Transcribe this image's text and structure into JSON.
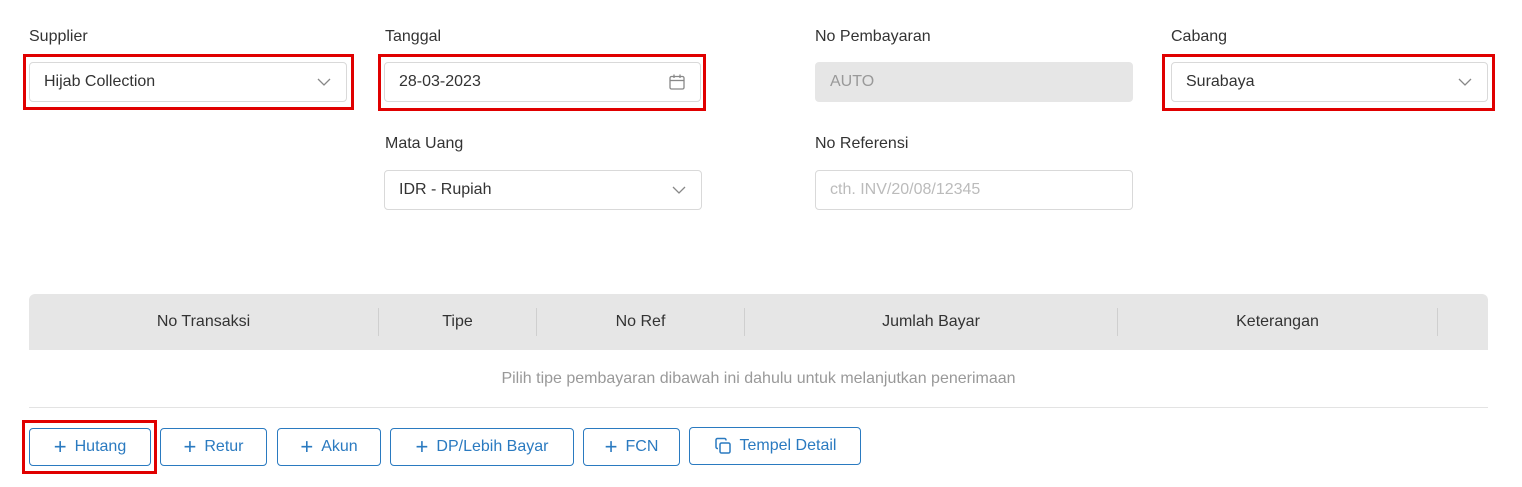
{
  "form": {
    "supplier": {
      "label": "Supplier",
      "value": "Hijab Collection"
    },
    "tanggal": {
      "label": "Tanggal",
      "value": "28-03-2023"
    },
    "no_pembayaran": {
      "label": "No Pembayaran",
      "value": "AUTO"
    },
    "cabang": {
      "label": "Cabang",
      "value": "Surabaya"
    },
    "mata_uang": {
      "label": "Mata Uang",
      "value": "IDR - Rupiah"
    },
    "no_referensi": {
      "label": "No Referensi",
      "placeholder": "cth. INV/20/08/12345"
    }
  },
  "table": {
    "headers": [
      "No Transaksi",
      "Tipe",
      "No Ref",
      "Jumlah Bayar",
      "Keterangan"
    ],
    "empty_message": "Pilih tipe pembayaran dibawah ini dahulu untuk melanjutkan penerimaan"
  },
  "buttons": {
    "hutang": "Hutang",
    "retur": "Retur",
    "akun": "Akun",
    "dp": "DP/Lebih Bayar",
    "fcn": "FCN",
    "tempel": "Tempel Detail"
  },
  "icons": {
    "dropdown": "chevron-down-icon",
    "calendar": "calendar-icon",
    "add": "plus-icon",
    "copy": "copy-icon"
  },
  "colors": {
    "accent": "#2a7ac0",
    "highlight": "#e00000",
    "disabled_bg": "#e6e6e6"
  }
}
